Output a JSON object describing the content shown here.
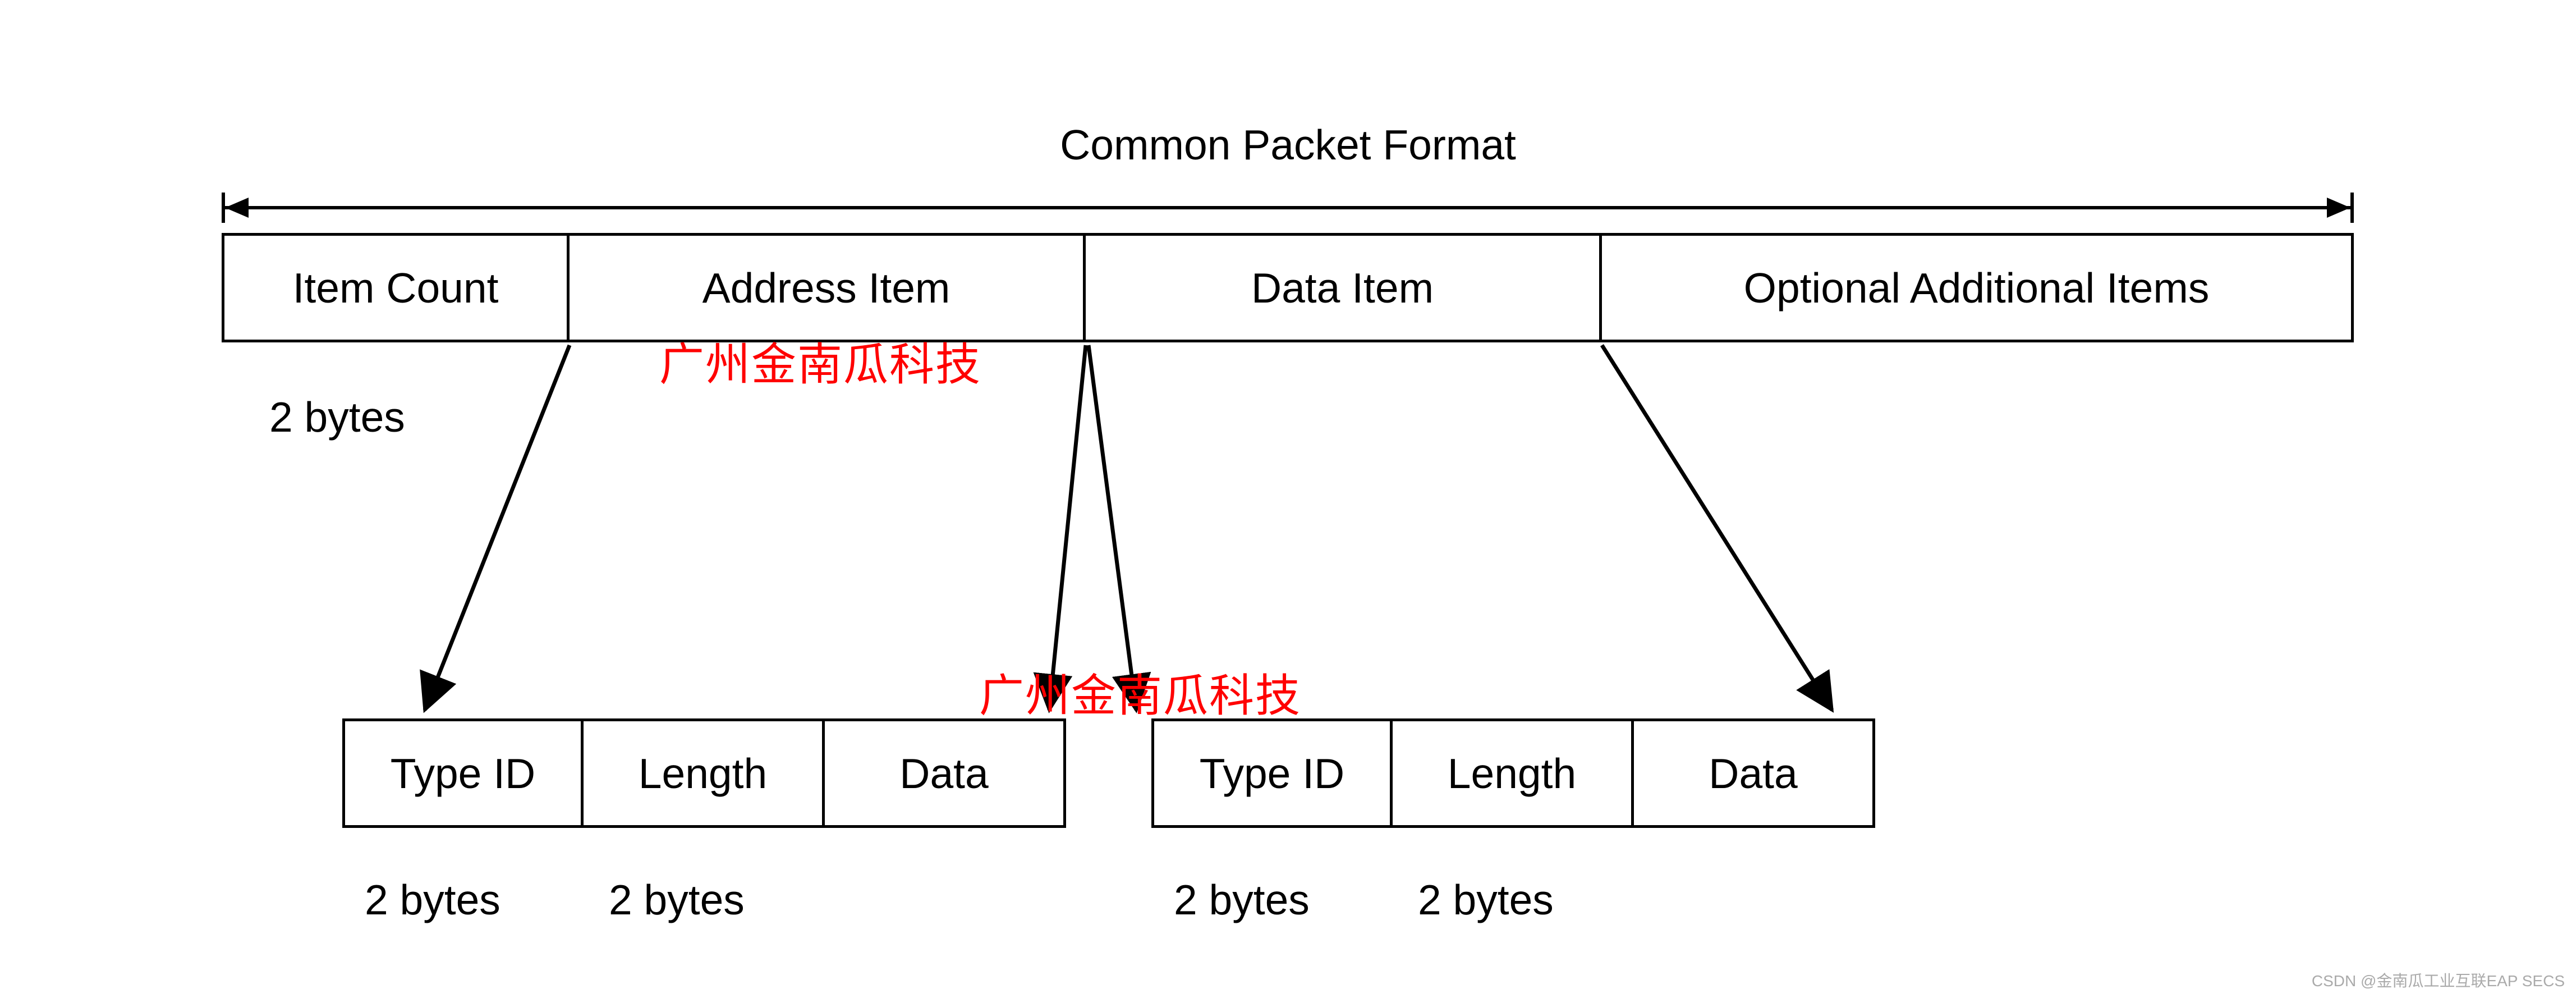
{
  "title": "Common Packet Format",
  "top_row": {
    "item_count": "Item Count",
    "address_item": "Address Item",
    "data_item": "Data Item",
    "optional_items": "Optional Additional Items",
    "item_count_size": "2 bytes"
  },
  "sub_item": {
    "type_id": "Type ID",
    "length": "Length",
    "data": "Data",
    "type_id_size": "2 bytes",
    "length_size": "2 bytes"
  },
  "watermark": "广州金南瓜科技",
  "footer": "CSDN @金南瓜工业互联EAP SECS"
}
